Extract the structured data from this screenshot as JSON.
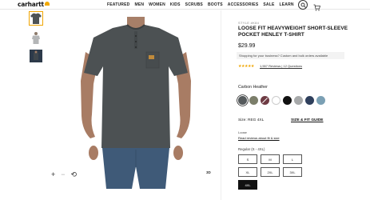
{
  "header": {
    "logo": "carhartt",
    "nav": [
      "FEATURED",
      "MEN",
      "WOMEN",
      "KIDS",
      "SCRUBS",
      "BOOTS",
      "ACCESSORIES",
      "SALE",
      "LEARN"
    ]
  },
  "gallery": {
    "rotate_label": "3D"
  },
  "product": {
    "style": "STYLE #K84",
    "title": "LOOSE FIT HEAVYWEIGHT SHORT-SLEEVE POCKET HENLEY T-SHIRT",
    "price": "$29.99",
    "promo": "Shopping for your business? Custom and bulk orders available",
    "promo_link": "available",
    "stars": "★★★★★",
    "reviews_link": "1,557 Reviews | 12 Questions",
    "color_label": "Carbon Heather",
    "swatches": [
      {
        "name": "Carbon Heather",
        "color": "#555a5c",
        "selected": true
      },
      {
        "name": "Moss",
        "color": "#7b7e6a"
      },
      {
        "name": "Burgundy",
        "color": "#6e3b43",
        "unavailable": true
      },
      {
        "name": "White",
        "color": "#ffffff"
      },
      {
        "name": "Black",
        "color": "#111111"
      },
      {
        "name": "Heather Gray",
        "color": "#a7a9aa"
      },
      {
        "name": "Navy",
        "color": "#2f3f5c"
      },
      {
        "name": "Light Blue",
        "color": "#7ba0b4"
      }
    ],
    "size_label": "Size: REG 4XL",
    "size_guide": "SIZE & FIT GUIDE",
    "fit_label": "Loose",
    "fit_link": "Read reviews about fit & size",
    "range_label": "Regular (S - 4XL)",
    "sizes": [
      "S",
      "M",
      "L",
      "XL",
      "2XL",
      "3XL",
      "4XL"
    ],
    "selected_size": "4XL"
  }
}
